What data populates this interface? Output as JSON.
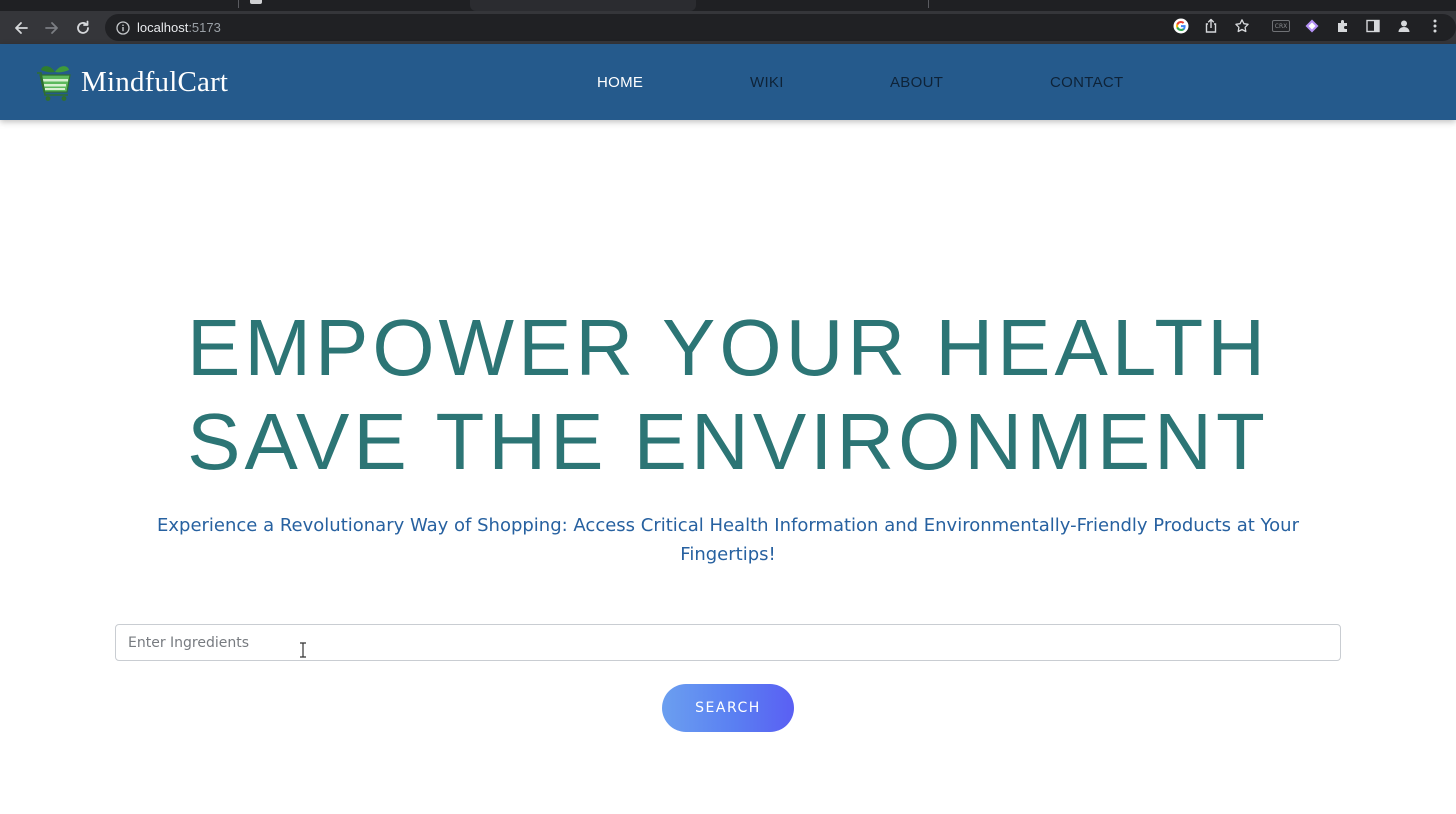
{
  "browser": {
    "url_host": "localhost",
    "url_port": ":5173",
    "icons": [
      "back-icon",
      "forward-icon",
      "reload-icon",
      "info-icon",
      "google-icon",
      "share-icon",
      "star-icon",
      "crx-icon",
      "extension-diamond-icon",
      "puzzle-icon",
      "sidepanel-icon",
      "profile-icon",
      "menu-icon"
    ],
    "crx_label": "CRX"
  },
  "header": {
    "brand": "MindfulCart",
    "nav": [
      {
        "label": "HOME",
        "active": true
      },
      {
        "label": "WIKI",
        "active": false
      },
      {
        "label": "ABOUT",
        "active": false
      },
      {
        "label": "CONTACT",
        "active": false
      }
    ]
  },
  "hero": {
    "line1": "EMPOWER YOUR HEALTH",
    "line2": "SAVE THE ENVIRONMENT",
    "subtitle": "Experience a Revolutionary Way of Shopping: Access Critical Health Information and Environmentally-Friendly Products at Your Fingertips!"
  },
  "search": {
    "placeholder": "Enter Ingredients",
    "value": "",
    "button_label": "SEARCH"
  },
  "colors": {
    "header_bg": "#255a8c",
    "hero_text": "#2c7575",
    "subtitle_text": "#2761a0",
    "button_gradient_start": "#6b9ff0",
    "button_gradient_end": "#5a5ff3"
  }
}
